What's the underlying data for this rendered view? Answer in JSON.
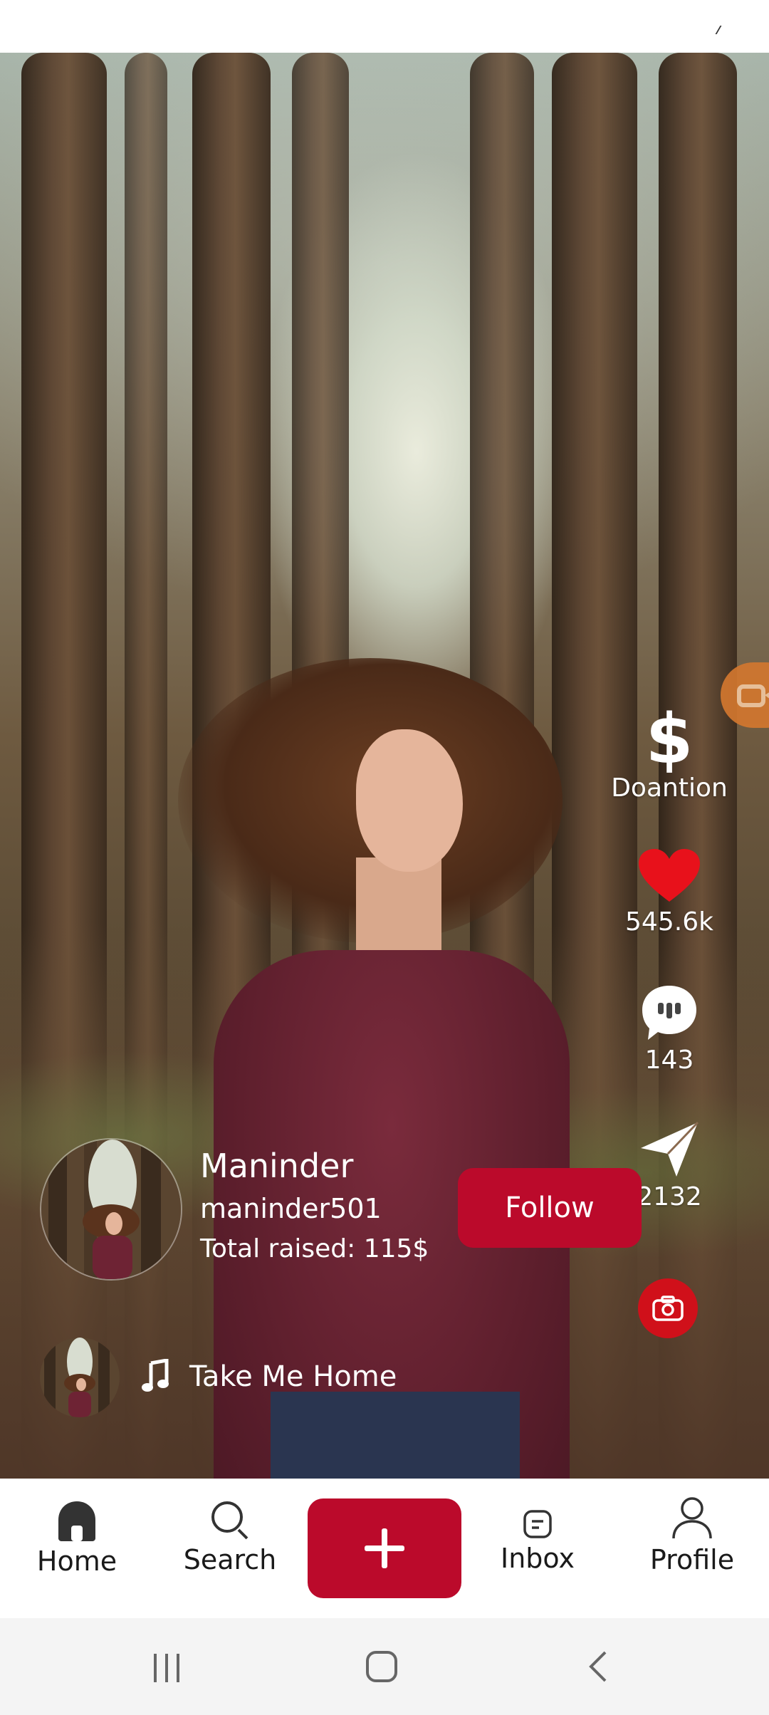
{
  "status_bar": {},
  "video": {
    "live_icon": "video-camera-icon"
  },
  "right_rail": {
    "donation": {
      "icon": "dollar-icon",
      "symbol": "$",
      "label": "Doantion"
    },
    "like": {
      "icon": "heart-icon",
      "count": "545.6k",
      "color": "#e8111b"
    },
    "comment": {
      "icon": "comment-icon",
      "count": "143"
    },
    "share": {
      "icon": "send-icon",
      "count": "2132"
    },
    "camera": {
      "icon": "camera-icon"
    }
  },
  "creator": {
    "name": "Maninder",
    "handle": "maninder501",
    "total_raised": "Total raised: 115$",
    "follow_label": "Follow"
  },
  "music": {
    "icon": "music-note-icon",
    "title": "Take Me Home"
  },
  "bottom_nav": {
    "items": [
      {
        "label": "Home",
        "icon": "home-icon"
      },
      {
        "label": "Search",
        "icon": "search-icon"
      },
      {
        "label": "",
        "icon": "plus-icon"
      },
      {
        "label": "Inbox",
        "icon": "inbox-icon"
      },
      {
        "label": "Profile",
        "icon": "profile-icon"
      }
    ]
  },
  "system_nav": {
    "items": [
      "recents-icon",
      "home-button-icon",
      "back-icon"
    ]
  },
  "colors": {
    "accent": "#bb0a2b",
    "heart": "#e8111b",
    "live": "#d2772f"
  }
}
